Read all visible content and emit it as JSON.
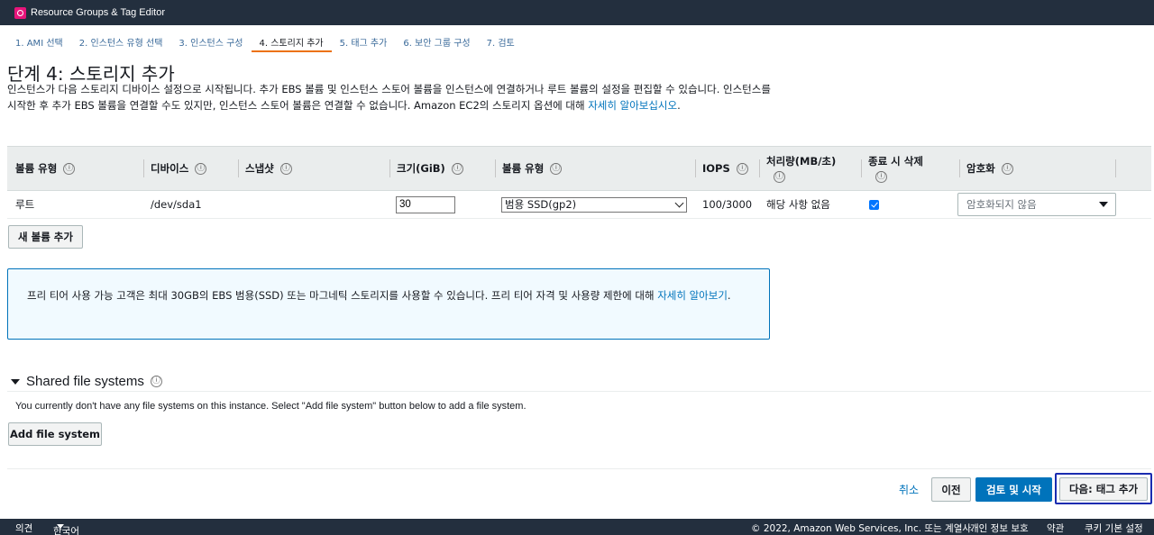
{
  "app": {
    "title": "Resource Groups & Tag Editor",
    "logo_icon": "resource-groups-icon",
    "accent": "#e7157b"
  },
  "steps": [
    {
      "label": "1. AMI 선택"
    },
    {
      "label": "2. 인스턴스 유형 선택"
    },
    {
      "label": "3. 인스턴스 구성"
    },
    {
      "label": "4. 스토리지 추가",
      "active": true
    },
    {
      "label": "5. 태그 추가"
    },
    {
      "label": "6. 보안 그룹 구성"
    },
    {
      "label": "7. 검토"
    }
  ],
  "page": {
    "title": "단계 4: 스토리지 추가",
    "description": "인스턴스가 다음 스토리지 디바이스 설정으로 시작됩니다. 추가 EBS 볼륨 및 인스턴스 스토어 볼륨을 인스턴스에 연결하거나 루트 볼륨의 설정을 편집할 수 있습니다. 인스턴스를 시작한 후 추가 EBS 볼륨을 연결할 수도 있지만, 인스턴스 스토어 볼륨은 연결할 수 없습니다. Amazon EC2의 스토리지 옵션에 대해 ",
    "description_link": "자세히 알아보십시오",
    "description_end": "."
  },
  "table": {
    "headers": {
      "volume_type": "볼륨 유형",
      "device": "디바이스",
      "snapshot": "스냅샷",
      "size": "크기(GiB)",
      "volume_kind": "볼륨 유형",
      "iops": "IOPS",
      "throughput": "처리량(MB/초)",
      "delete_on_termination": "종료 시 삭제",
      "encryption": "암호화"
    },
    "info_icon": "ⓘ",
    "row": {
      "volume_type": "루트",
      "device": "/dev/sda1",
      "snapshot": "",
      "size": "30",
      "volume_kind": "범용 SSD(gp2)",
      "iops": "100/3000",
      "throughput": "해당 사항 없음",
      "delete_on_termination": true,
      "encryption": "암호화되지 않음"
    }
  },
  "add_volume_label": "새 볼륨 추가",
  "notice": {
    "text": "프리 티어 사용 가능 고객은 최대 30GB의 EBS 범용(SSD) 또는 마그네틱 스토리지를 사용할 수 있습니다. 프리 티어 자격 및 사용량 제한에 대해 ",
    "link": "자세히 알아보기",
    "end": "."
  },
  "shared_fs": {
    "title": "Shared file systems",
    "message": "You currently don't have any file systems on this instance. Select \"Add file system\" button below to add a file system.",
    "add_button": "Add file system"
  },
  "actions": {
    "cancel": "취소",
    "previous": "이전",
    "review_launch": "검토 및 시작",
    "next": "다음: 태그 추가"
  },
  "footer": {
    "feedback": "의견",
    "language": "한국어",
    "copyright": "© 2022, Amazon Web Services, Inc. 또는 계열사.",
    "privacy": "개인 정보 보호",
    "terms": "약관",
    "cookies": "쿠키 기본 설정"
  }
}
